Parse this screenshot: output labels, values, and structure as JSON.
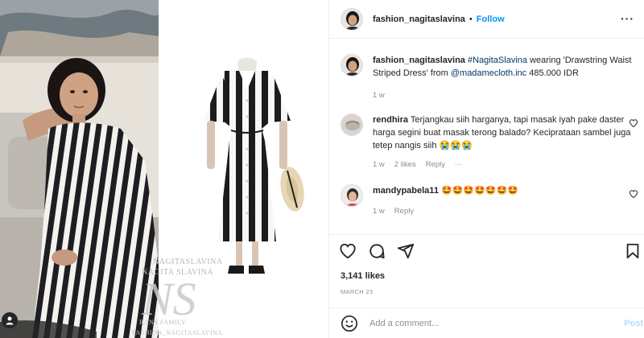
{
  "post": {
    "username": "fashion_nagitaslavina",
    "separator": "•",
    "follow_label": "Follow",
    "more_label": "···",
    "caption": {
      "username": "fashion_nagitaslavina",
      "hashtag": "#NagitaSlavina",
      "text_before_mention": " wearing 'Drawstring Waist Striped Dress' from ",
      "mention": "@madamecloth.inc",
      "text_after_mention": " 485.000 IDR",
      "age": "1 w"
    },
    "comments": [
      {
        "username": "rendhira",
        "text": "Terjangkau siih harganya, tapi masak iyah pake daster harga segini buat masak terong balado? Keciprataan sambel juga tetep nangis siih 😭😭😭",
        "age": "1 w",
        "likes": "2 likes",
        "reply": "Reply",
        "options": "···"
      },
      {
        "username": "mandypabela11",
        "text": "🤩🤩🤩🤩🤩🤩🤩",
        "age": "1 w",
        "reply": "Reply"
      }
    ],
    "likes": "3,141 likes",
    "date": "MARCH 23",
    "add_comment": {
      "placeholder": "Add a comment...",
      "post_label": "Post"
    }
  },
  "media": {
    "watermark_top": "NAGITASLAVINA",
    "watermark_mid": "NAGITA SLAVINA",
    "logo_letters": "NS",
    "watermark_family": "RANS FAMILY",
    "watermark_bottom": "FASHION_NAGITASLAVINA"
  },
  "icons": {
    "heart": "heart-icon",
    "comment": "comment-icon",
    "share": "share-icon",
    "save": "bookmark-icon",
    "emoji": "emoji-icon",
    "user_tag": "user-tag-icon"
  },
  "colors": {
    "link_blue": "#0095f6",
    "mention_blue": "#00376b",
    "muted_gray": "#8e8e8e",
    "border": "#efefef",
    "post_disabled": "#b2dffc"
  }
}
